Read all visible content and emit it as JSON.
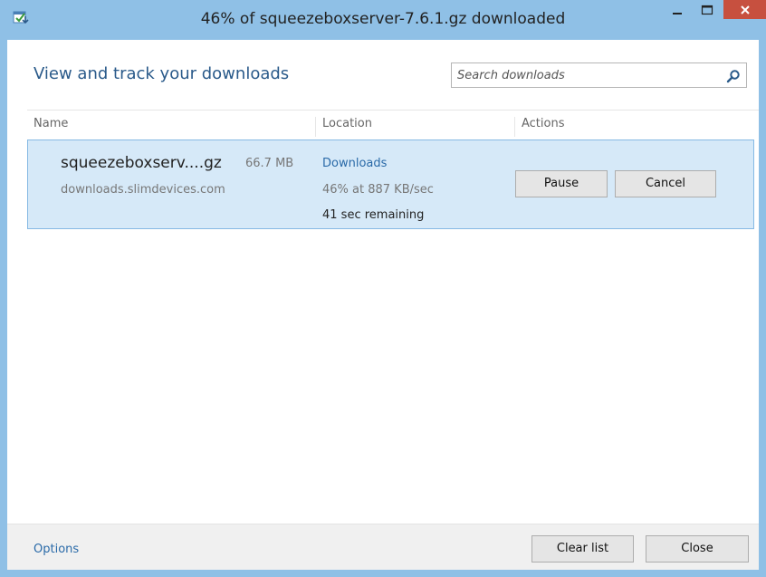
{
  "window": {
    "title": "46% of squeezeboxserver-7.6.1.gz downloaded",
    "icon": "download-manager-icon",
    "controls": {
      "minimize": "–",
      "maximize": "□",
      "close": "×"
    }
  },
  "header": {
    "heading": "View and track your downloads",
    "search": {
      "placeholder": "Search downloads",
      "value": ""
    }
  },
  "columns": {
    "name": "Name",
    "location": "Location",
    "actions": "Actions"
  },
  "downloads": [
    {
      "filename": "squeezeboxserv....gz",
      "size": "66.7 MB",
      "source": "downloads.slimdevices.com",
      "location": "Downloads",
      "progress": "46% at 887 KB/sec",
      "progress_value": 0.46,
      "remaining": "41 sec remaining",
      "actions": {
        "pause": "Pause",
        "cancel": "Cancel"
      }
    }
  ],
  "footer": {
    "options": "Options",
    "clear": "Clear list",
    "close": "Close"
  },
  "colors": {
    "accent": "#8fc0e6",
    "link": "#2a6aa8",
    "selection": "#d6e9f8",
    "close_button": "#c7503f"
  }
}
